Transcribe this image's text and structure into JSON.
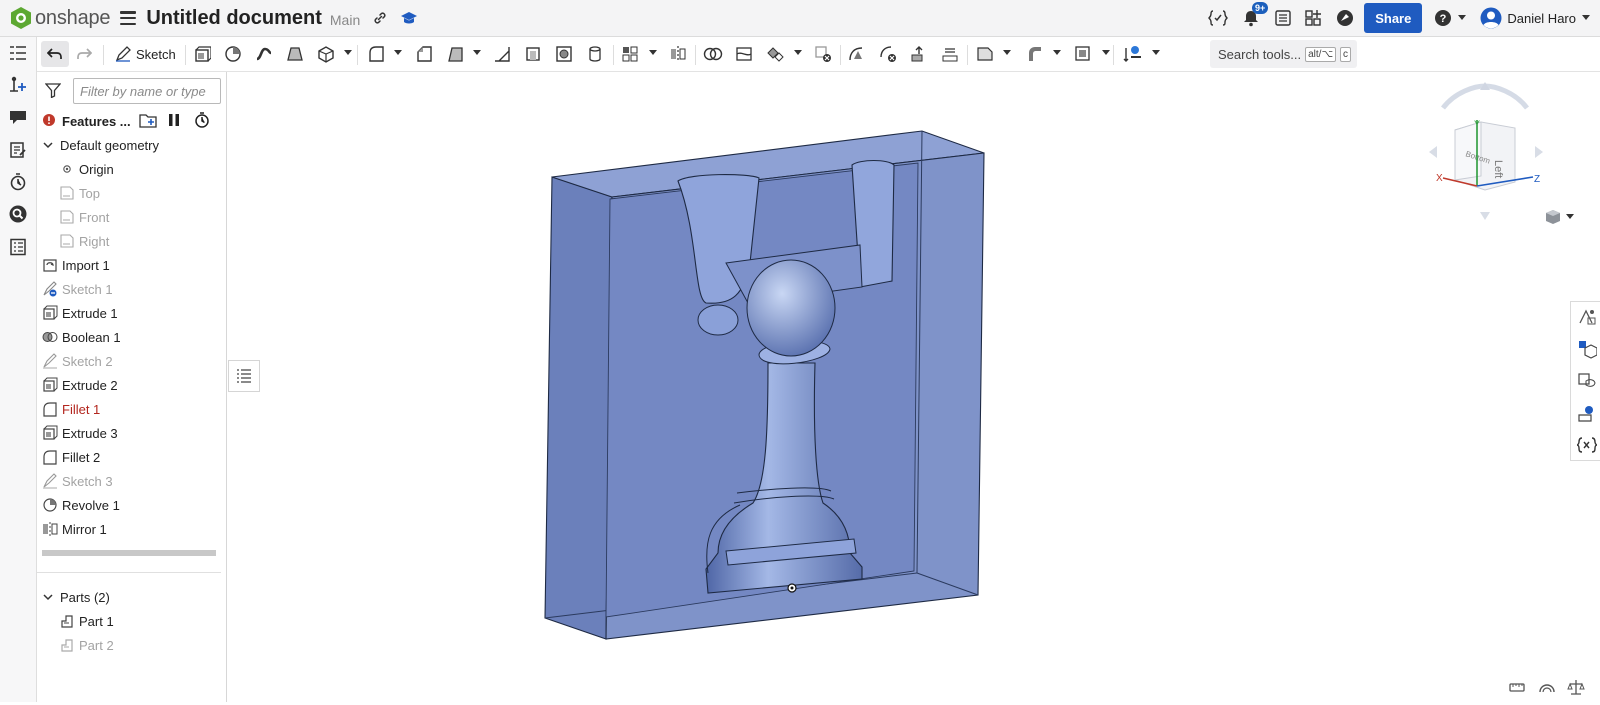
{
  "app": {
    "brand": "onshape",
    "title": "Untitled document",
    "branch": "Main"
  },
  "topbar": {
    "notification_count": "9+",
    "share_label": "Share",
    "help_label": "?",
    "user_name": "Daniel Haro"
  },
  "toolbar": {
    "sketch_label": "Sketch",
    "search_label": "Search tools...",
    "shortcut_mod": "alt/⌥",
    "shortcut_key": "c"
  },
  "features_panel": {
    "filter_placeholder": "Filter by name or type",
    "header": "Features ...",
    "items": [
      {
        "label": "Default geometry",
        "state": "normal",
        "icon": "chevron-down-icon"
      },
      {
        "label": "Origin",
        "state": "normal",
        "icon": "origin-icon"
      },
      {
        "label": "Top",
        "state": "muted",
        "icon": "plane-icon"
      },
      {
        "label": "Front",
        "state": "muted",
        "icon": "plane-icon"
      },
      {
        "label": "Right",
        "state": "muted",
        "icon": "plane-icon"
      },
      {
        "label": "Import 1",
        "state": "normal",
        "icon": "import-icon"
      },
      {
        "label": "Sketch 1",
        "state": "muted",
        "icon": "sketch-icon"
      },
      {
        "label": "Extrude 1",
        "state": "normal",
        "icon": "extrude-icon"
      },
      {
        "label": "Boolean 1",
        "state": "normal",
        "icon": "boolean-icon"
      },
      {
        "label": "Sketch 2",
        "state": "muted",
        "icon": "sketch-icon"
      },
      {
        "label": "Extrude 2",
        "state": "normal",
        "icon": "extrude-icon"
      },
      {
        "label": "Fillet 1",
        "state": "error",
        "icon": "fillet-icon"
      },
      {
        "label": "Extrude 3",
        "state": "normal",
        "icon": "extrude-icon"
      },
      {
        "label": "Fillet 2",
        "state": "normal",
        "icon": "fillet-icon"
      },
      {
        "label": "Sketch 3",
        "state": "muted",
        "icon": "sketch-icon"
      },
      {
        "label": "Revolve 1",
        "state": "normal",
        "icon": "revolve-icon"
      },
      {
        "label": "Mirror 1",
        "state": "normal",
        "icon": "mirror-icon"
      }
    ],
    "parts_header": "Parts (2)",
    "parts": [
      {
        "label": "Part 1",
        "state": "normal",
        "icon": "part-icon"
      },
      {
        "label": "Part 2",
        "state": "muted",
        "icon": "part-icon"
      }
    ]
  },
  "view_cube": {
    "face_front": "Left",
    "face_side": "Bottom",
    "axis_x": "X",
    "axis_y": "Y",
    "axis_z": "Z"
  },
  "colors": {
    "accent": "#1f5bc0",
    "model_fill": "#7f93c9",
    "error": "#b3261e"
  }
}
